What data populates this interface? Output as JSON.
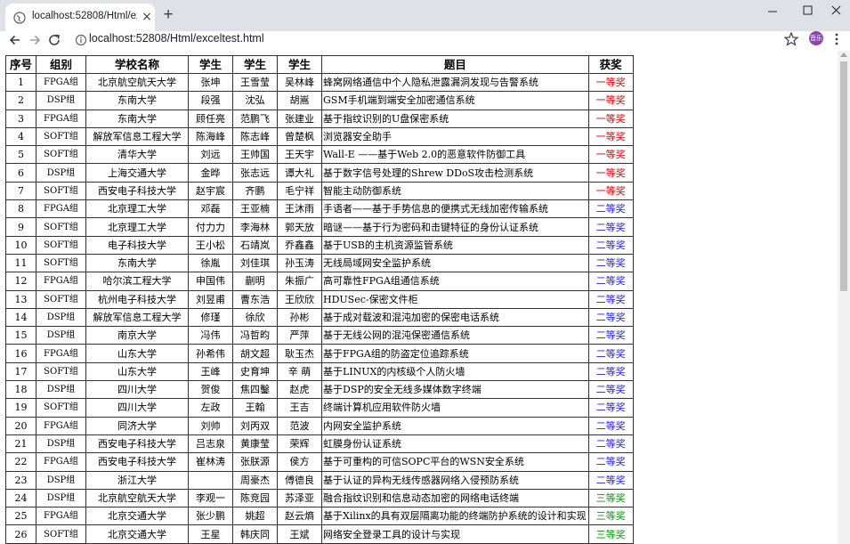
{
  "browser": {
    "tab_title": "localhost:52808/Html/exceltest.h",
    "tab_close": "×",
    "new_tab": "+",
    "url": "localhost:52808/Html/exceltest.html",
    "avatar_label": "音乐"
  },
  "table": {
    "headers": [
      "序号",
      "组别",
      "学校名称",
      "学生",
      "学生",
      "学生",
      "题目",
      "获奖"
    ],
    "award_colors": {
      "一等奖": "#e00000",
      "二等奖": "#1e1edc",
      "三等奖": "#0a9a0a"
    },
    "rows": [
      [
        "1",
        "FPGA组",
        "北京航空航天大学",
        "张坤",
        "王雪莹",
        "吴林峰",
        "蜂窝网络通信中个人隐私泄露漏洞发现与告警系统",
        "一等奖"
      ],
      [
        "2",
        "DSP组",
        "东南大学",
        "段强",
        "沈弘",
        "胡嵩",
        "GSM手机端到端安全加密通信系统",
        "一等奖"
      ],
      [
        "3",
        "FPGA组",
        "东南大学",
        "顾任亮",
        "范鹏飞",
        "张建业",
        "基于指纹识别的U盘保密系统",
        "一等奖"
      ],
      [
        "4",
        "SOFT组",
        "解放军信息工程大学",
        "陈海峰",
        "陈志峰",
        "曾楚枫",
        "浏览器安全助手",
        "一等奖"
      ],
      [
        "5",
        "SOFT组",
        "清华大学",
        "刘远",
        "王帅国",
        "王天宇",
        "Wall-E ——基于Web 2.0的恶意软件防御工具",
        "一等奖"
      ],
      [
        "6",
        "DSP组",
        "上海交通大学",
        "金晔",
        "张志远",
        "谭大礼",
        "基于数字信号处理的Shrew DDoS攻击检测系统",
        "一等奖"
      ],
      [
        "7",
        "SOFT组",
        "西安电子科技大学",
        "赵宇宸",
        "齐鹏",
        "毛宁祥",
        "智能主动防御系统",
        "一等奖"
      ],
      [
        "8",
        "FPGA组",
        "北京理工大学",
        "邓磊",
        "王亚楠",
        "王沐雨",
        "手语者——基于手势信息的便携式无线加密传输系统",
        "二等奖"
      ],
      [
        "9",
        "SOFT组",
        "北京理工大学",
        "付力力",
        "李海林",
        "郭天放",
        "暗谜——基于行为密码和击键特征的身份认证系统",
        "二等奖"
      ],
      [
        "10",
        "SOFT组",
        "电子科技大学",
        "王小松",
        "石靖岚",
        "乔鑫鑫",
        "基于USB的主机资源监管系统",
        "二等奖"
      ],
      [
        "11",
        "SOFT组",
        "东南大学",
        "徐胤",
        "刘佳琪",
        "孙玉涛",
        "无线局域网安全监护系统",
        "二等奖"
      ],
      [
        "12",
        "FPGA组",
        "哈尔滨工程大学",
        "申国伟",
        "蒯明",
        "朱振广",
        "高可靠性FPGA组通信系统",
        "二等奖"
      ],
      [
        "13",
        "SOFT组",
        "杭州电子科技大学",
        "刘昱甫",
        "曹东浩",
        "王欣欣",
        "HDUSec-保密文件柜",
        "二等奖"
      ],
      [
        "14",
        "DSP组",
        "解放军信息工程大学",
        "修瑾",
        "徐欣",
        "孙彬",
        "基于成对载波和混沌加密的保密电话系统",
        "二等奖"
      ],
      [
        "15",
        "DSP组",
        "南京大学",
        "冯伟",
        "冯哲昀",
        "严萍",
        "基于无线公网的混沌保密通信系统",
        "二等奖"
      ],
      [
        "16",
        "FPGA组",
        "山东大学",
        "孙希伟",
        "胡文超",
        "耿玉杰",
        "基于FPGA组的防盗定位追踪系统",
        "二等奖"
      ],
      [
        "17",
        "SOFT组",
        "山东大学",
        "王峰",
        "史育坤",
        "辛 萌",
        "基于LINUX的内核级个人防火墙",
        "二等奖"
      ],
      [
        "18",
        "DSP组",
        "四川大学",
        "贺俊",
        "焦四鑿",
        "赵虎",
        "基于DSP的安全无线多媒体数字终端",
        "二等奖"
      ],
      [
        "19",
        "SOFT组",
        "四川大学",
        "左政",
        "王翰",
        "王吉",
        "终端计算机应用软件防火墙",
        "二等奖"
      ],
      [
        "20",
        "FPGA组",
        "同济大学",
        "刘帅",
        "刘丙双",
        "范波",
        "内网安全监护系统",
        "二等奖"
      ],
      [
        "21",
        "DSP组",
        "西安电子科技大学",
        "吕志泉",
        "黄康莹",
        "荣辉",
        "虹膜身份认证系统",
        "二等奖"
      ],
      [
        "22",
        "FPGA组",
        "西安电子科技大学",
        "崔林涛",
        "张朕源",
        "侯方",
        "基于可重构的可信SOPC平台的WSN安全系统",
        "二等奖"
      ],
      [
        "23",
        "DSP组",
        "浙江大学",
        "",
        "周豪杰",
        "傅德良",
        "基于认证的异构无线传感器网络入侵预防系统",
        "二等奖"
      ],
      [
        "24",
        "DSP组",
        "北京航空航天大学",
        "李观一",
        "陈竞园",
        "苏泽亚",
        "融合指纹识别和信息动态加密的网络电话终端",
        "三等奖"
      ],
      [
        "25",
        "FPGA组",
        "北京交通大学",
        "张少鹏",
        "姚超",
        "赵云熵",
        "基于Xilinx的具有双层隔离功能的终端防护系统的设计和实现",
        "三等奖"
      ],
      [
        "26",
        "SOFT组",
        "北京交通大学",
        "王星",
        "韩庆同",
        "王斌",
        "网络安全登录工具的设计与实现",
        "三等奖"
      ]
    ]
  }
}
